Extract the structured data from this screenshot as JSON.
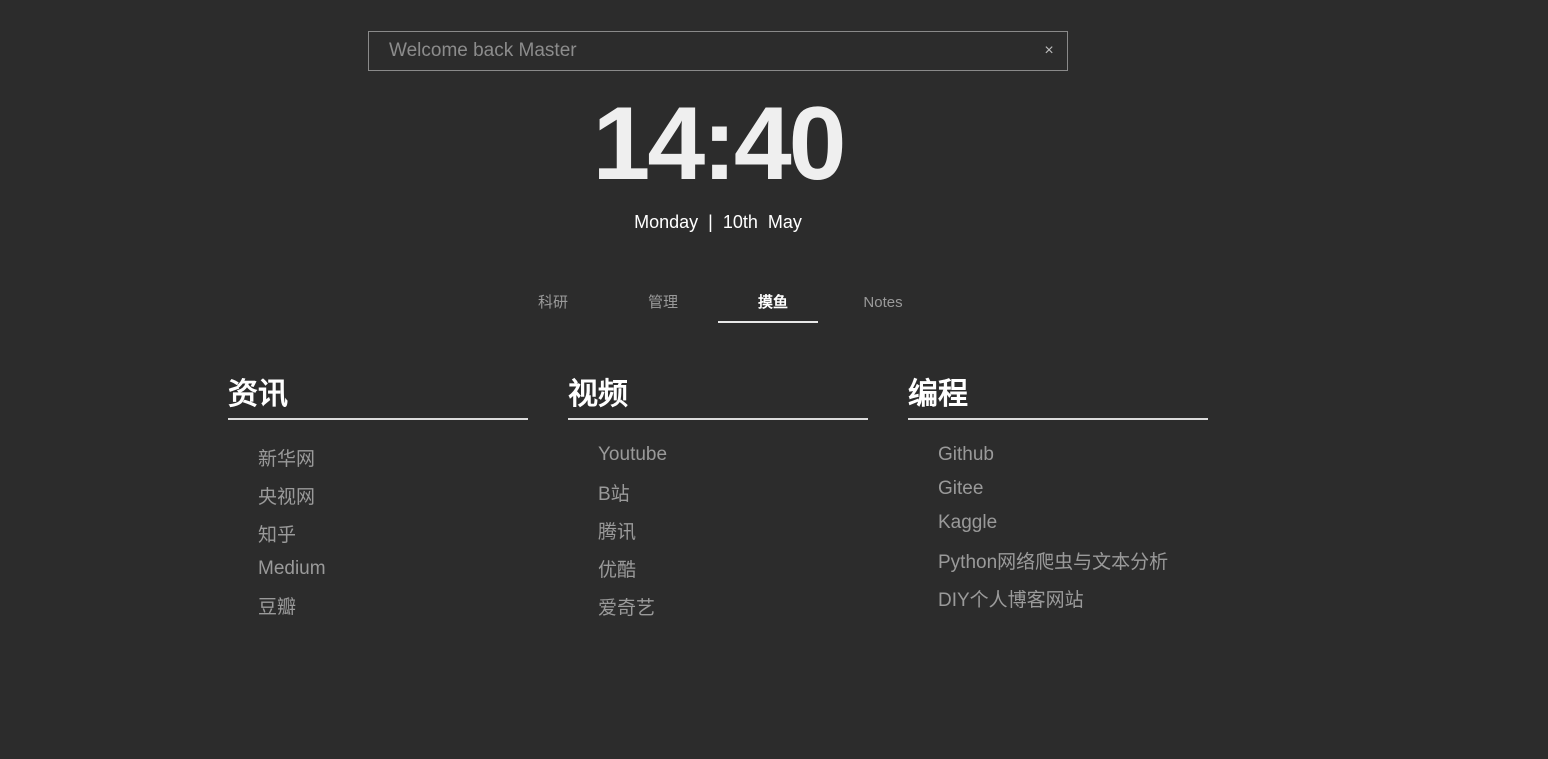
{
  "search": {
    "placeholder": "Welcome back Master",
    "value": "",
    "clear_label": "×"
  },
  "clock": {
    "time": "14:40",
    "date": "Monday  |  10th  May"
  },
  "tabs": [
    {
      "label": "科研",
      "active": false
    },
    {
      "label": "管理",
      "active": false
    },
    {
      "label": "摸鱼",
      "active": true
    },
    {
      "label": "Notes",
      "active": false
    }
  ],
  "columns": [
    {
      "title": "资讯",
      "links": [
        "新华网",
        "央视网",
        "知乎",
        "Medium",
        "豆瓣"
      ]
    },
    {
      "title": "视频",
      "links": [
        "Youtube",
        "B站",
        "腾讯",
        "优酷",
        "爱奇艺"
      ]
    },
    {
      "title": "编程",
      "links": [
        "Github",
        "Gitee",
        "Kaggle",
        "Python网络爬虫与文本分析",
        "DIY个人博客网站"
      ]
    }
  ],
  "colors": {
    "background": "#2c2c2c",
    "text_primary": "#ffffff",
    "text_muted": "#9a9a9a",
    "border": "#8a8a8a"
  }
}
